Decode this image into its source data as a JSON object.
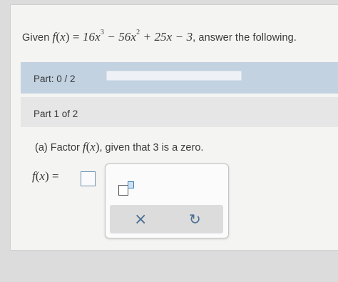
{
  "question": {
    "given": "Given",
    "func": "f",
    "var": "x",
    "expr_a": "16x",
    "exp_a": "3",
    "expr_b": "− 56x",
    "exp_b": "2",
    "expr_c": "+ 25x − 3",
    "tail": ", answer the following."
  },
  "part_progress": {
    "label": "Part: 0 / 2",
    "completed": 0,
    "total": 2,
    "colors": {
      "bar": "#c3d2e1",
      "fill": "#5b8fc2"
    }
  },
  "part_header": {
    "label": "Part 1 of 2"
  },
  "prompt": {
    "prefix": "(a) Factor",
    "func": "f",
    "var": "x",
    "middle": ", given that",
    "zero": "3",
    "suffix": "is a zero."
  },
  "answer": {
    "func": "f",
    "var": "x",
    "equals": "=",
    "value": ""
  },
  "palette": {
    "exponent_icon": "exponent-template-icon",
    "close_glyph": "×",
    "undo_glyph": "↺"
  }
}
